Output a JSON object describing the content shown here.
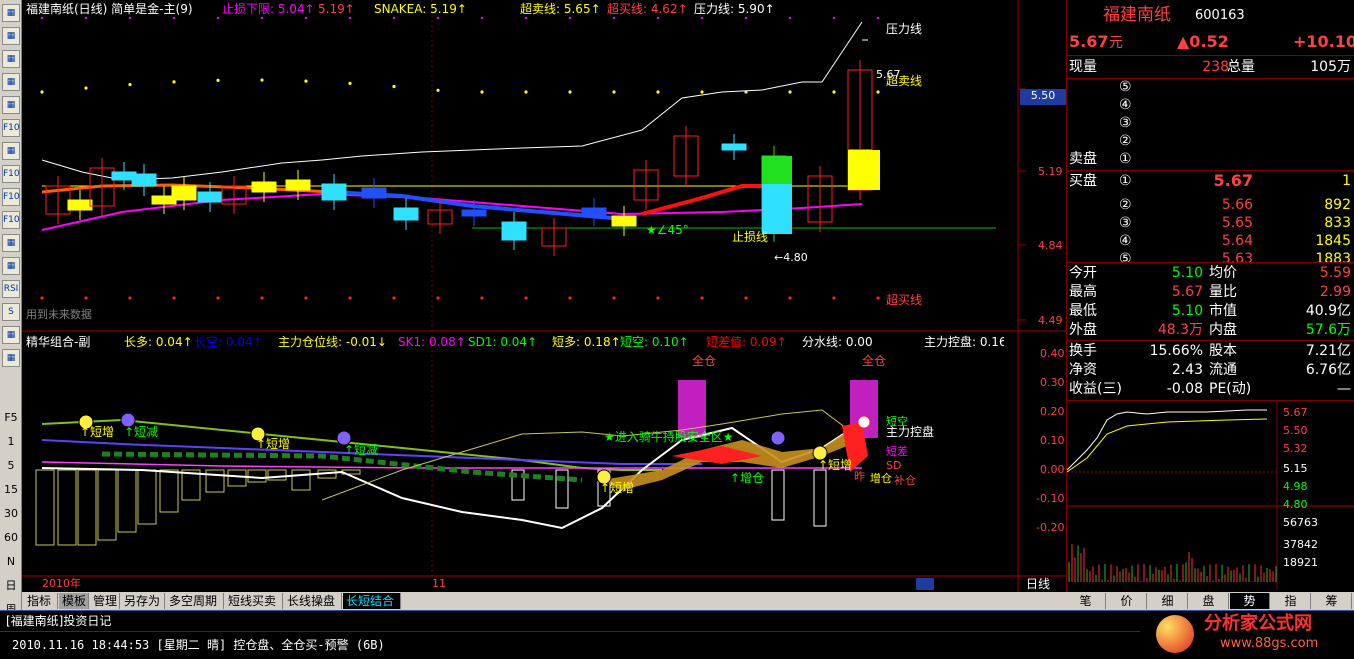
{
  "toolbar": {
    "icons": [
      "list",
      "grid",
      "line",
      "candle",
      "table",
      "F10",
      "notes",
      "F10",
      "F10",
      "F10",
      "search",
      "chart",
      "RSI",
      "S",
      "arrow",
      "pen"
    ],
    "numbers": [
      "F5",
      "1",
      "5",
      "15",
      "30",
      "60",
      "N",
      "日",
      "周"
    ]
  },
  "main_chart": {
    "title": "福建南纸(日线) 简单是金-主(9)",
    "legend": [
      {
        "text": "止损下限: 5.04↑",
        "color": "#ff00ff"
      },
      {
        "text": "5.19↑",
        "color": "#ff4040"
      },
      {
        "text": "SNAKEA: 5.19↑",
        "color": "#ffff00"
      },
      {
        "text": "超卖线: 5.65↑",
        "color": "#ffff00"
      },
      {
        "text": "超买线: 4.62↑",
        "color": "#ff4040"
      },
      {
        "text": "压力线: 5.90↑",
        "color": "#ffffff"
      }
    ],
    "annotations": {
      "pressure": "压力线",
      "oversold": "超卖线",
      "overbought": "超买线",
      "stoploss": "止损线",
      "angle": "★∠45°",
      "low_mark": "←4.80",
      "high_mark": "5.67",
      "future": "用到未来数据"
    },
    "price_axis": [
      "5.50",
      "5.19",
      "4.84",
      "4.49"
    ]
  },
  "sub_chart": {
    "title": "精华组合-副",
    "legend": [
      {
        "text": "长多: 0.04↑",
        "color": "#ffff00"
      },
      {
        "text": "长空: 0.04↑",
        "color": "#0000ff"
      },
      {
        "text": "主力仓位线: -0.01↓",
        "color": "#ffff00"
      },
      {
        "text": "SK1: 0.08↑",
        "color": "#ff00ff"
      },
      {
        "text": "SD1: 0.04↑",
        "color": "#00ff00"
      },
      {
        "text": "短多: 0.18↑",
        "color": "#ffff00"
      },
      {
        "text": "短空: 0.10↑",
        "color": "#00ff00"
      },
      {
        "text": "短差值: 0.09↑",
        "color": "#ff0000"
      },
      {
        "text": "分水线: 0.00",
        "color": "#ffffff"
      },
      {
        "text": "主力控盘: 0.16",
        "color": "#ffffff"
      }
    ],
    "labels": {
      "full1": "全仓",
      "full2": "全仓",
      "entry": "★进入骑牛持股安全区★",
      "add1": "↑短增",
      "dec1": "↑短减",
      "add2": "↑短增",
      "dec2": "↑短减",
      "add3": "↑短增",
      "add4": "↑短增",
      "inc_pos": "↑增仓",
      "control": "主力控盘",
      "short_entry": "短空",
      "short_diff": "短差",
      "sd": "SD",
      "buy_pos": "补仓",
      "increase": "增仓",
      "yesterday": "昨"
    },
    "axis": [
      "0.40",
      "0.30",
      "0.20",
      "0.10",
      "0.00",
      "-0.10",
      "-0.20"
    ]
  },
  "date_axis": {
    "year": "2010年",
    "month": "11",
    "period": "日线"
  },
  "tabs": [
    "指标",
    "模板",
    "管理",
    "另存为",
    "多空周期",
    "短线买卖",
    "长线操盘",
    "长短结合"
  ],
  "right_tabs": [
    "笔",
    "价",
    "细",
    "盘",
    "势",
    "指",
    "筹"
  ],
  "quote": {
    "name": "福建南纸",
    "code": "600163",
    "price": "5.67",
    "unit": "元",
    "change": "▲0.52",
    "pct": "+10.10",
    "volume_label": "现量",
    "volume": "238",
    "total_label": "总量",
    "total": "105万",
    "sell_label": "卖盘",
    "buy_label": "买盘",
    "sell_levels": [
      "⑤",
      "④",
      "③",
      "②",
      "①"
    ],
    "buy_levels": [
      {
        "lvl": "①",
        "price": "5.67",
        "vol": "1"
      },
      {
        "lvl": "②",
        "price": "5.66",
        "vol": "892"
      },
      {
        "lvl": "③",
        "price": "5.65",
        "vol": "833"
      },
      {
        "lvl": "④",
        "price": "5.64",
        "vol": "1845"
      },
      {
        "lvl": "⑤",
        "price": "5.63",
        "vol": "1883"
      }
    ],
    "stats": [
      {
        "k1": "今开",
        "v1": "5.10",
        "k2": "均价",
        "v2": "5.59",
        "c1": "#00ff00",
        "c2": "#ff4040"
      },
      {
        "k1": "最高",
        "v1": "5.67",
        "k2": "量比",
        "v2": "2.99",
        "c1": "#ff4040",
        "c2": "#ff4040"
      },
      {
        "k1": "最低",
        "v1": "5.10",
        "k2": "市值",
        "v2": "40.9亿",
        "c1": "#00ff00",
        "c2": "#ffffff"
      },
      {
        "k1": "外盘",
        "v1": "48.3万",
        "k2": "内盘",
        "v2": "57.6万",
        "c1": "#ff4040",
        "c2": "#00ff00"
      }
    ],
    "stats2": [
      {
        "k1": "换手",
        "v1": "15.66%",
        "k2": "股本",
        "v2": "7.21亿"
      },
      {
        "k1": "净资",
        "v1": "2.43",
        "k2": "流通",
        "v2": "6.76亿"
      },
      {
        "k1": "收益(三)",
        "v1": "-0.08",
        "k2": "PE(动)",
        "v2": "—"
      }
    ],
    "mini_axis": [
      "5.67",
      "5.50",
      "5.32",
      "5.15",
      "4.98",
      "4.80",
      "56763",
      "37842",
      "18921"
    ]
  },
  "diary": {
    "title": "[福建南纸]投资日记",
    "entry": "2010.11.16 18:44:53 [星期二 晴] 控仓盘、全仓买-预警 (6B)",
    "watermark": "分析家公式网",
    "watermark_url": "www.88gs.com"
  }
}
